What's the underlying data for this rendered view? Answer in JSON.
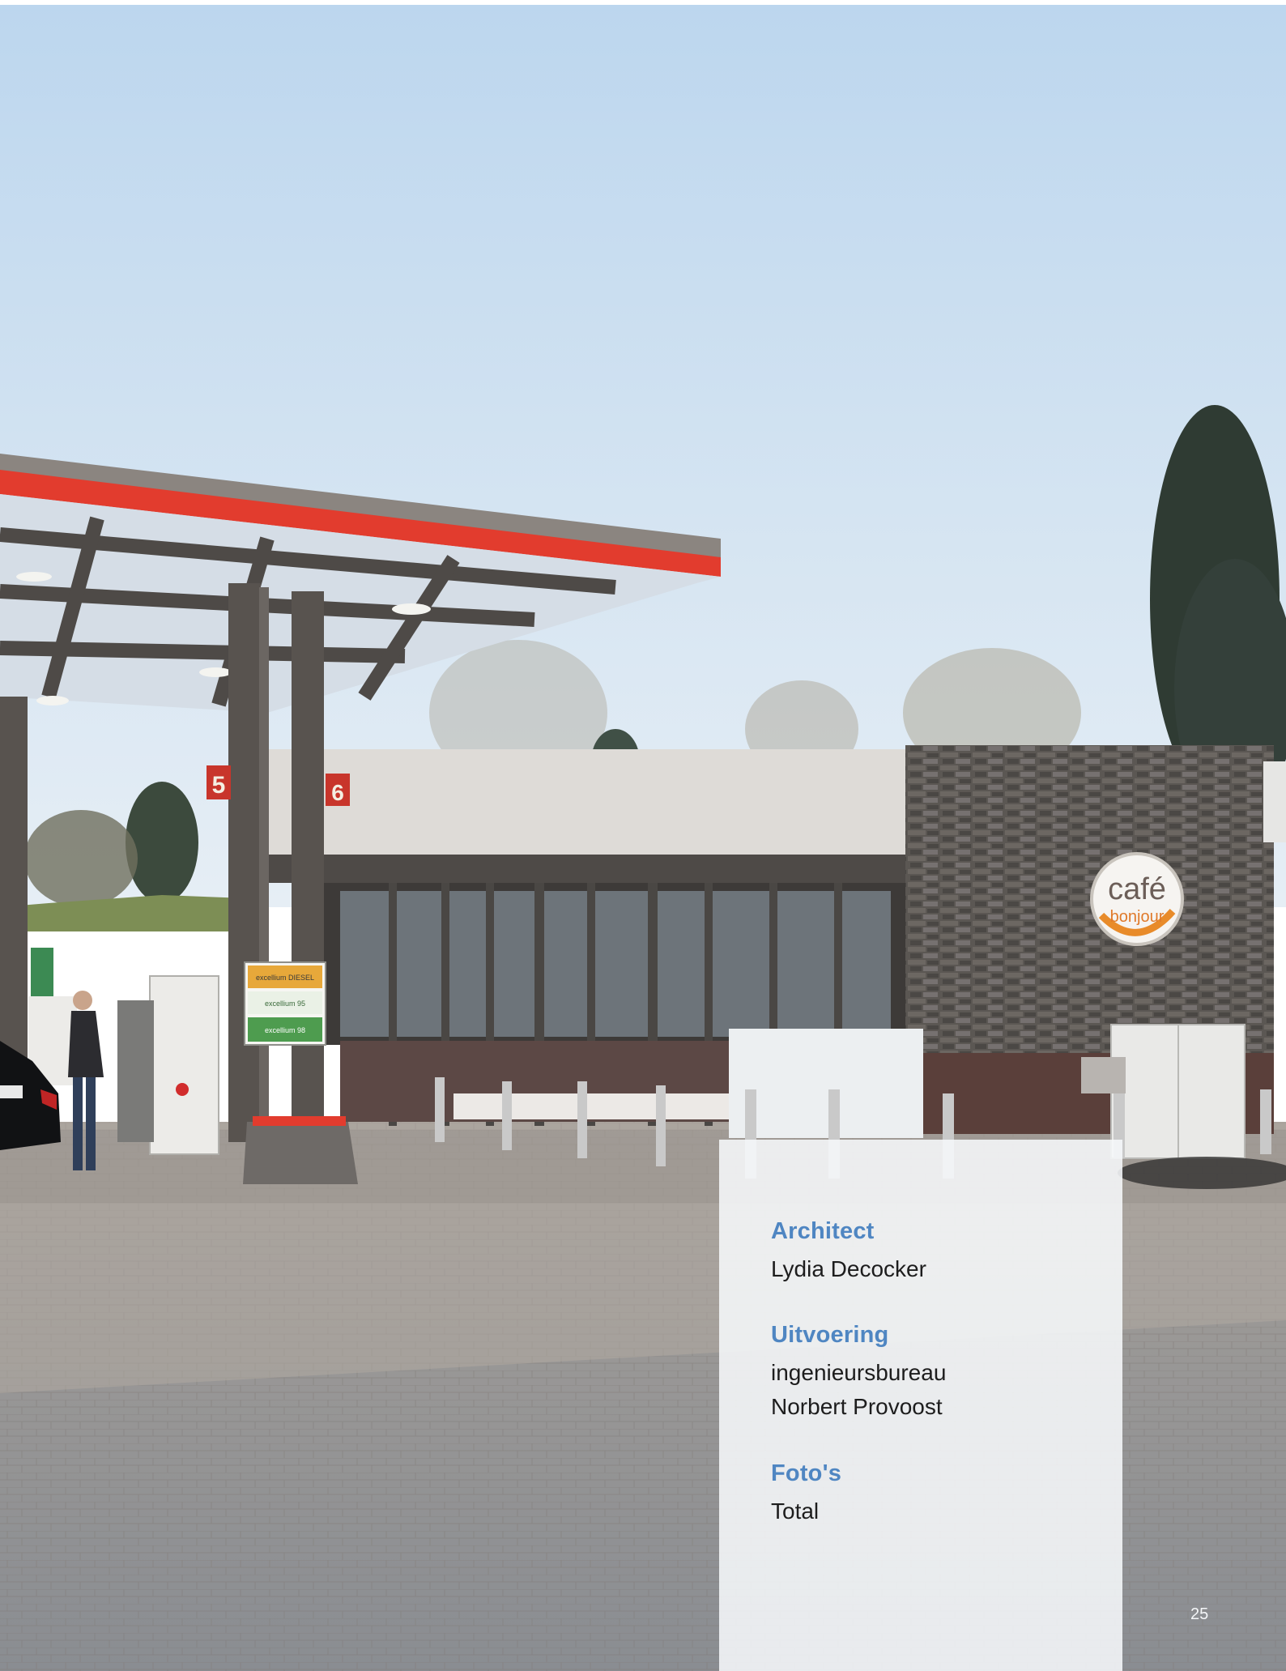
{
  "credits": [
    {
      "label": "Architect",
      "lines": [
        "Lydia Decocker"
      ]
    },
    {
      "label": "Uitvoering",
      "lines": [
        "ingenieursbureau",
        "Norbert Provoost"
      ]
    },
    {
      "label": "Foto's",
      "lines": [
        "Total"
      ]
    }
  ],
  "signage": {
    "pump_numbers": [
      "5",
      "6"
    ],
    "fuel_panels": [
      "excellium DIESEL",
      "excellium 95",
      "excellium 98"
    ],
    "cafe_logo": [
      "café",
      "bonjour"
    ]
  },
  "page_number": "25"
}
